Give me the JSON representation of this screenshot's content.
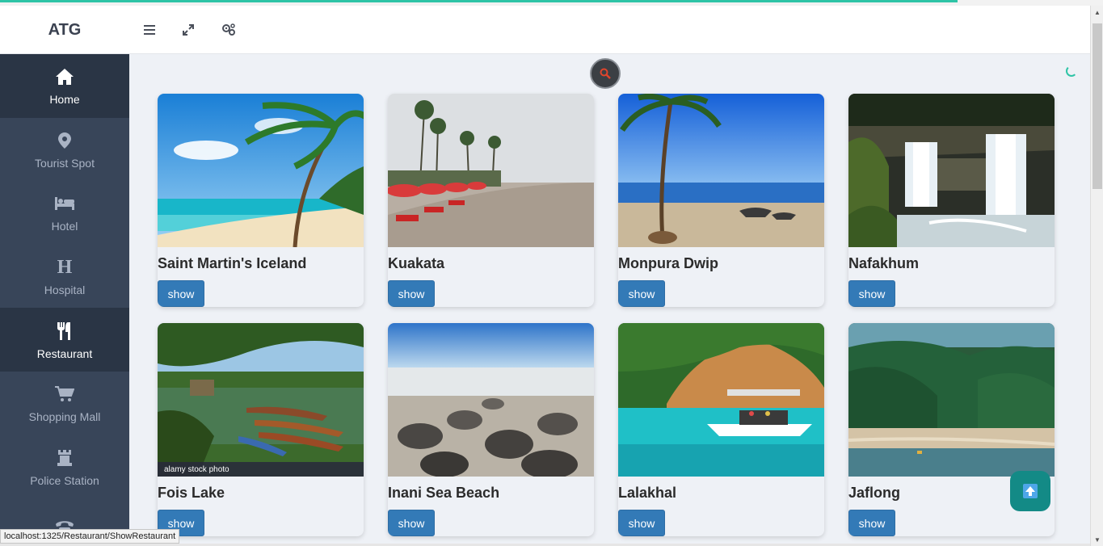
{
  "header": {
    "brand": "ATG",
    "icons": [
      "menu-icon",
      "expand-icon",
      "settings-icon"
    ]
  },
  "sidebar": {
    "items": [
      {
        "label": "Home",
        "icon": "home-icon",
        "active": true
      },
      {
        "label": "Tourist Spot",
        "icon": "map-marker-icon",
        "active": false
      },
      {
        "label": "Hotel",
        "icon": "bed-icon",
        "active": false
      },
      {
        "label": "Hospital",
        "icon": "hospital-h-icon",
        "active": false
      },
      {
        "label": "Restaurant",
        "icon": "cutlery-icon",
        "active": true
      },
      {
        "label": "Shopping Mall",
        "icon": "cart-icon",
        "active": false
      },
      {
        "label": "Police Station",
        "icon": "tower-icon",
        "active": false
      },
      {
        "label": "",
        "icon": "phone-icon",
        "active": false
      }
    ]
  },
  "main": {
    "search_icon": "search-icon",
    "cards": [
      {
        "title": "Saint Martin's Iceland",
        "button": "show",
        "scene": "tropical-beach"
      },
      {
        "title": "Kuakata",
        "button": "show",
        "scene": "beach-chairs"
      },
      {
        "title": "Monpura Dwip",
        "button": "show",
        "scene": "palm-boats"
      },
      {
        "title": "Nafakhum",
        "button": "show",
        "scene": "waterfall"
      },
      {
        "title": "Fois Lake",
        "button": "show",
        "scene": "lake-boats",
        "watermark": "alamy stock photo"
      },
      {
        "title": "Inani Sea Beach",
        "button": "show",
        "scene": "rocky-beach"
      },
      {
        "title": "Lalakhal",
        "button": "show",
        "scene": "turquoise-river"
      },
      {
        "title": "Jaflong",
        "button": "show",
        "scene": "green-hills-river"
      }
    ]
  },
  "scroll_top_icon": "arrow-up-icon",
  "status_url": "localhost:1325/Restaurant/ShowRestaurant",
  "colors": {
    "sidebar": "#384559",
    "sidebar_active": "#2a3545",
    "button": "#337ab7",
    "accent": "#2ec4a6",
    "scroll_top": "#138a86"
  }
}
